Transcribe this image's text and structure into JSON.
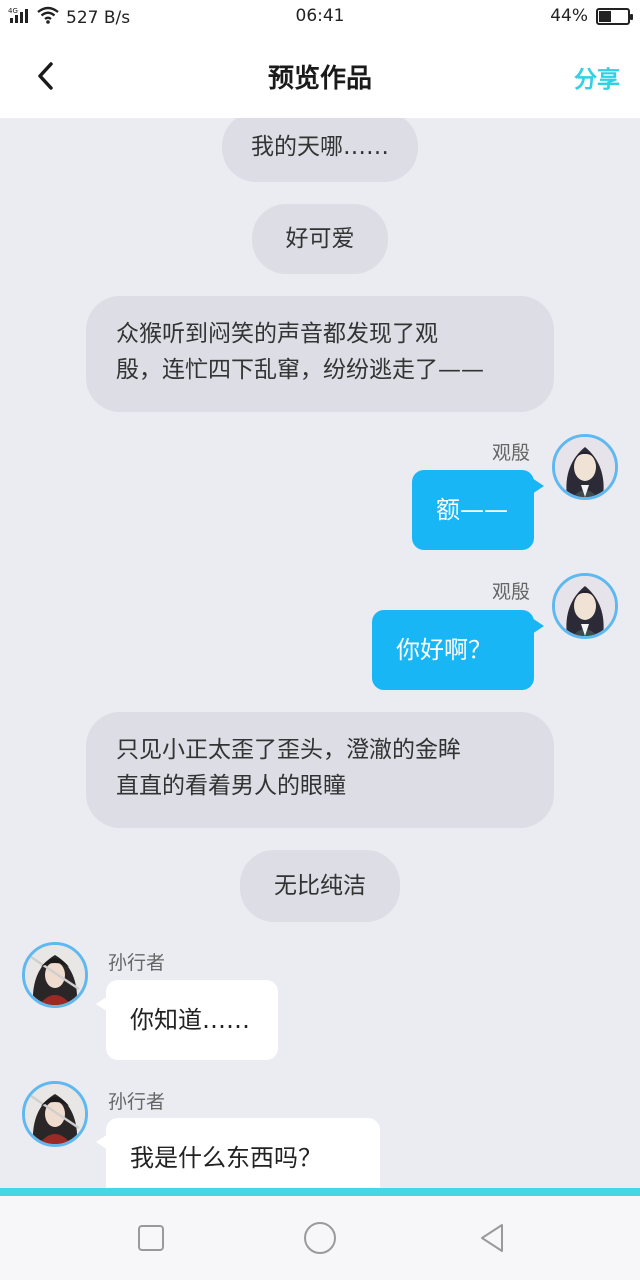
{
  "status_bar": {
    "signal": "4G",
    "network_speed": "527 B/s",
    "time": "06:41",
    "battery_percent": "44%",
    "battery_level": 0.44
  },
  "header": {
    "back_icon": "chevron-left-icon",
    "title": "预览作品",
    "share_label": "分享",
    "share_color": "#31d0e4"
  },
  "messages": {
    "narr1": "我的天哪……",
    "narr2": "好可爱",
    "narr3_line1": "众猴听到闷笑的声音都发现了观",
    "narr3_line2": "殷，连忙四下乱窜，纷纷逃走了——",
    "msg1_name": "观殷",
    "msg1_text": "额——",
    "msg2_name": "观殷",
    "msg2_text": "你好啊？",
    "narr4_line1": "只见小正太歪了歪头，澄澈的金眸",
    "narr4_line2": "直直的看着男人的眼瞳",
    "narr5": "无比纯洁",
    "msg3_name": "孙行者",
    "msg3_text": "你知道……",
    "msg4_name": "孙行者",
    "msg4_text": "我是什么东西吗？"
  },
  "colors": {
    "right_bubble": "#19b6f5",
    "narration_bg": "#dcdde5",
    "background": "#ebecf1"
  },
  "nav": {
    "recent_icon": "square-icon",
    "home_icon": "circle-icon",
    "back_icon": "triangle-back-icon"
  }
}
